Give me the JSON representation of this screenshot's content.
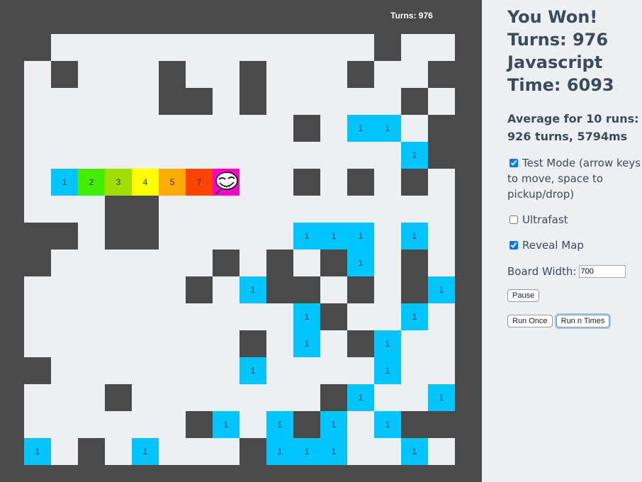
{
  "board": {
    "turns_label": "Turns: 976",
    "grid_cols": 17,
    "cells": [
      "WWWWWWWWWWWWWWWWWW",
      "W.WWWWWWWWWWWWWWWW"
    ]
  },
  "panel": {
    "result": "You Won! Turns: 976 Javascript Time: 6093",
    "average": "Average for 10 runs: 926 turns, 5794ms",
    "test_mode_label": "Test Mode (arrow keys to move, space to pickup/drop)",
    "ultrafast_label": "Ultrafast",
    "reveal_map_label": "Reveal Map",
    "board_width_label": "Board Width:",
    "board_width_value": "700",
    "pause_label": "Pause",
    "run_once_label": "Run Once",
    "run_n_label": "Run n Times"
  },
  "colors": {
    "wall": "#4a4a4a",
    "floor": "#edf0f2",
    "gold": "#00c5ff",
    "player": "#ff00cc"
  },
  "stair_cells": [
    {
      "label": "1",
      "color": "#00c5ff"
    },
    {
      "label": "2",
      "color": "#44ee00"
    },
    {
      "label": "3",
      "color": "#a0e000"
    },
    {
      "label": "4",
      "color": "#ffff00"
    },
    {
      "label": "5",
      "color": "#ffaa00"
    },
    {
      "label": "7",
      "color": "#ff4400"
    }
  ],
  "gold_cells": [
    {
      "r": 4,
      "c": 13,
      "label": "1"
    },
    {
      "r": 4,
      "c": 14,
      "label": "1"
    },
    {
      "r": 5,
      "c": 15,
      "label": "1"
    },
    {
      "r": 8,
      "c": 11,
      "label": "1"
    },
    {
      "r": 8,
      "c": 12,
      "label": "1"
    },
    {
      "r": 8,
      "c": 13,
      "label": "1"
    },
    {
      "r": 8,
      "c": 15,
      "label": "1"
    },
    {
      "r": 9,
      "c": 13,
      "label": "1"
    },
    {
      "r": 10,
      "c": 9,
      "label": "1"
    },
    {
      "r": 10,
      "c": 16,
      "label": "1"
    },
    {
      "r": 11,
      "c": 11,
      "label": "1"
    },
    {
      "r": 11,
      "c": 15,
      "label": "1"
    },
    {
      "r": 12,
      "c": 11,
      "label": "1"
    },
    {
      "r": 12,
      "c": 14,
      "label": "1"
    },
    {
      "r": 13,
      "c": 9,
      "label": "1"
    },
    {
      "r": 13,
      "c": 14,
      "label": "1"
    },
    {
      "r": 14,
      "c": 13,
      "label": "1"
    },
    {
      "r": 14,
      "c": 16,
      "label": "1"
    },
    {
      "r": 15,
      "c": 8,
      "label": "1"
    },
    {
      "r": 15,
      "c": 10,
      "label": "1"
    },
    {
      "r": 15,
      "c": 12,
      "label": "1"
    },
    {
      "r": 15,
      "c": 14,
      "label": "1"
    },
    {
      "r": 16,
      "c": 1,
      "label": "1"
    },
    {
      "r": 16,
      "c": 5,
      "label": "1"
    },
    {
      "r": 16,
      "c": 10,
      "label": "1"
    },
    {
      "r": 16,
      "c": 11,
      "label": "1"
    },
    {
      "r": 16,
      "c": 12,
      "label": "1"
    },
    {
      "r": 16,
      "c": 15,
      "label": "1"
    }
  ]
}
